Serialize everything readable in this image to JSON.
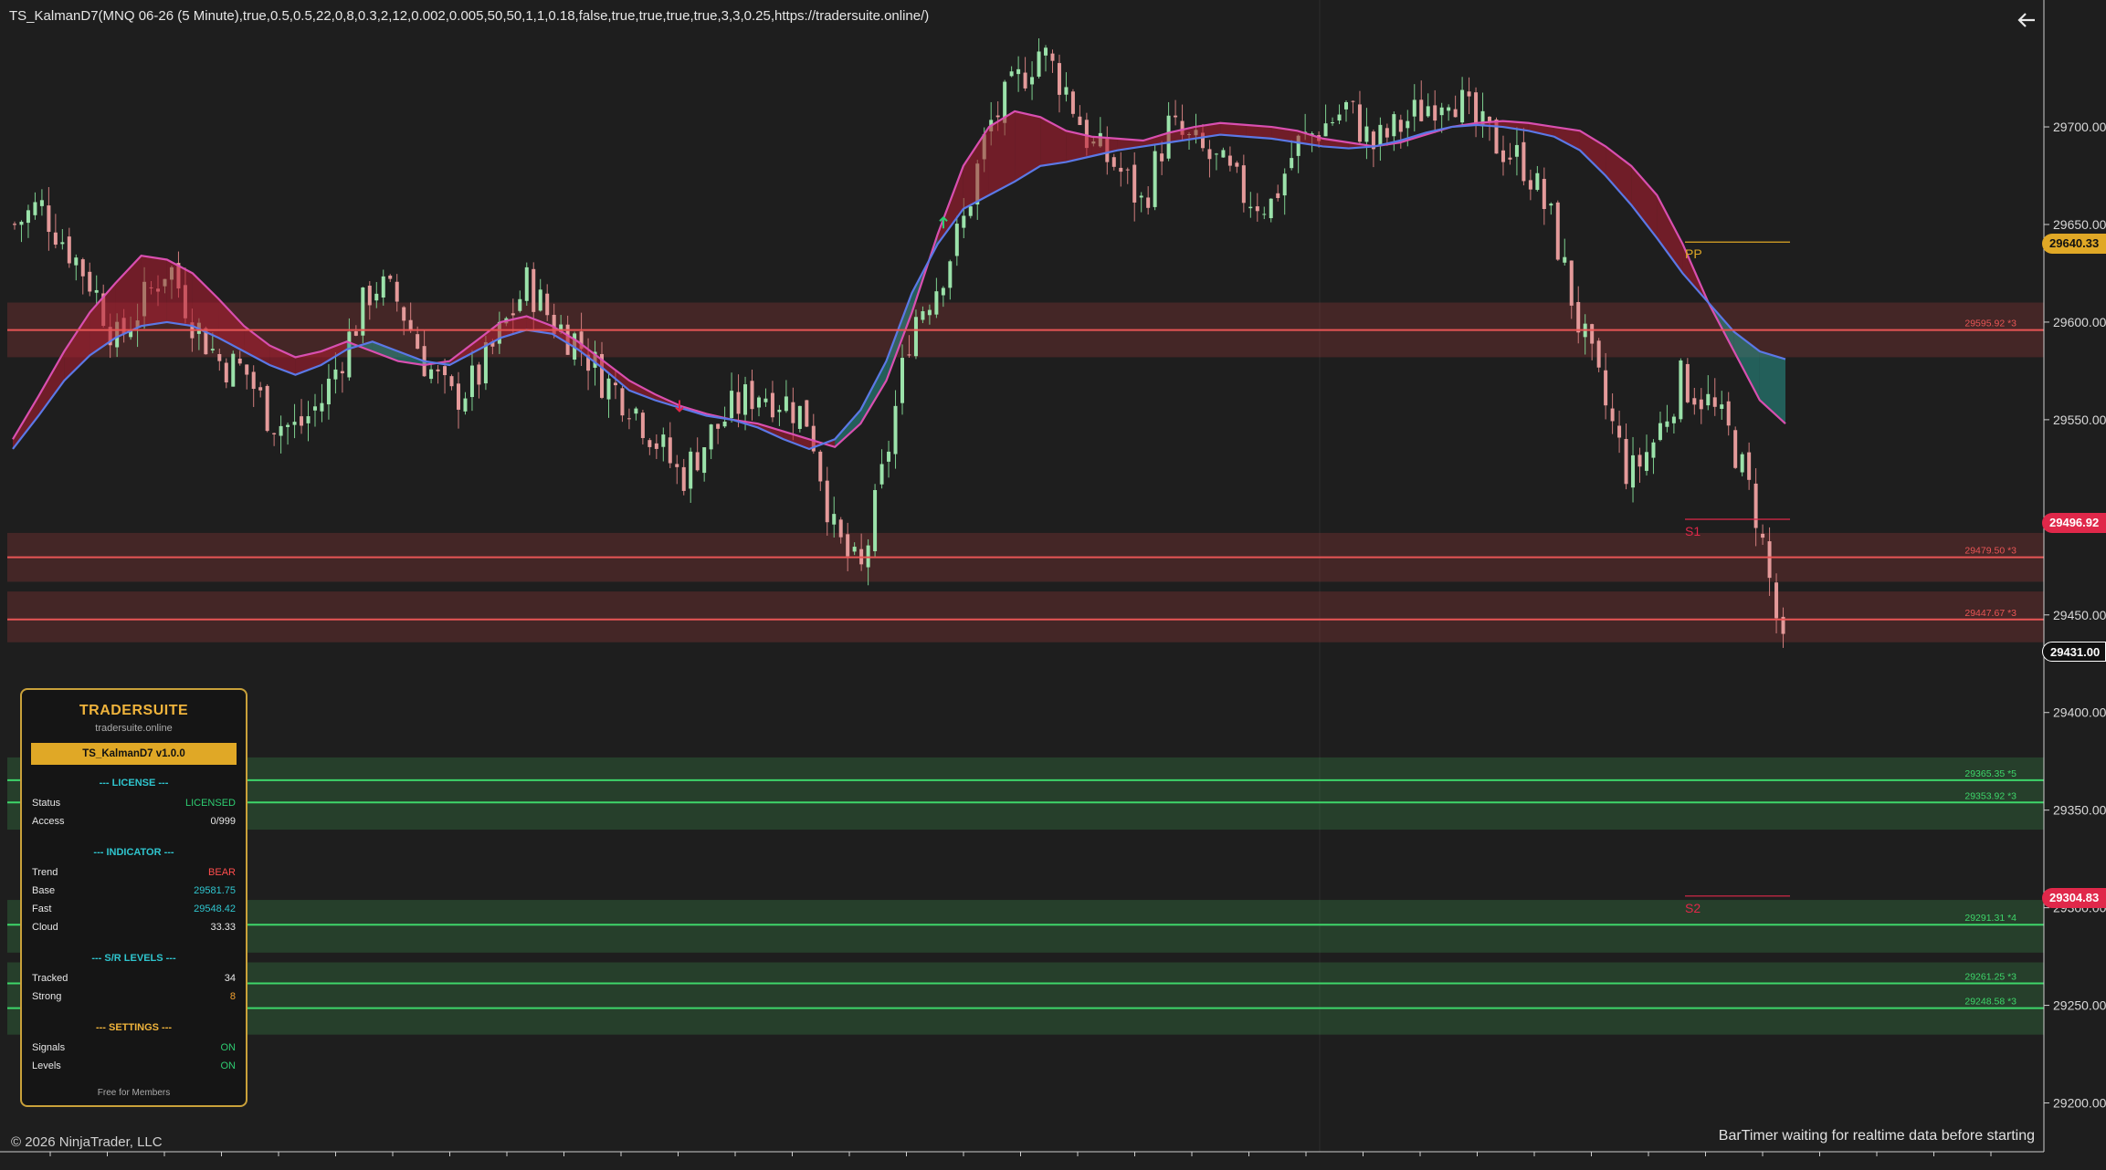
{
  "header": {
    "indicator_title": "TS_KalmanD7(MNQ 06-26 (5 Minute),true,0.5,0.5,22,0,8,0.3,2,12,0.002,0.005,50,50,1,1,0.18,false,true,true,true,true,3,3,0.25,https://tradersuite.online/)"
  },
  "footer": {
    "copyright": "© 2026 NinjaTrader, LLC",
    "bartimer": "BarTimer waiting for realtime data before starting"
  },
  "price_tags": [
    {
      "text": "29640.33",
      "price": 29640.33,
      "bg": "#e0a826",
      "fg": "#111111"
    },
    {
      "text": "29496.92",
      "price": 29496.92,
      "bg": "#e0284a",
      "fg": "#ffffff"
    },
    {
      "text": "29431.00",
      "price": 29431.0,
      "bg": "#111111",
      "fg": "#ffffff",
      "border": "#ffffff"
    },
    {
      "text": "29304.83",
      "price": 29304.83,
      "bg": "#e0284a",
      "fg": "#ffffff"
    }
  ],
  "panel": {
    "title": "TRADERSUITE",
    "subtitle": "tradersuite.online",
    "version": "TS_KalmanD7 v1.0.0",
    "license_header": "--- LICENSE ---",
    "status_label": "Status",
    "status_value": "LICENSED",
    "access_label": "Access",
    "access_value": "0/999",
    "indicator_header": "--- INDICATOR ---",
    "trend_label": "Trend",
    "trend_value": "BEAR",
    "base_label": "Base",
    "base_value": "29581.75",
    "fast_label": "Fast",
    "fast_value": "29548.42",
    "cloud_label": "Cloud",
    "cloud_value": "33.33",
    "sr_header": "--- S/R LEVELS ---",
    "tracked_label": "Tracked",
    "tracked_value": "34",
    "strong_label": "Strong",
    "strong_value": "8",
    "settings_header": "--- SETTINGS ---",
    "signals_label": "Signals",
    "signals_value": "ON",
    "levels_label": "Levels",
    "levels_value": "ON",
    "footer": "Free for Members",
    "colors": {
      "green": "#2ecc71",
      "red": "#ff4d4d",
      "cyan": "#2fc5ce",
      "orange": "#f0a030",
      "gold": "#e0a826"
    }
  },
  "chart_data": {
    "type": "candlestick",
    "instrument": "MNQ 06-26",
    "interval": "5 Minute",
    "ylim": [
      29175,
      29765
    ],
    "yticks": [
      {
        "value": 29200,
        "label": "29200.00"
      },
      {
        "value": 29250,
        "label": "29250.00"
      },
      {
        "value": 29300,
        "label": "29300.00"
      },
      {
        "value": 29350,
        "label": "29350.00"
      },
      {
        "value": 29400,
        "label": "29400.00"
      },
      {
        "value": 29450,
        "label": "29450.00"
      },
      {
        "value": 29500,
        "label": "29500.00"
      },
      {
        "value": 29550,
        "label": "29550.00"
      },
      {
        "value": 29600,
        "label": "29600.00"
      },
      {
        "value": 29650,
        "label": "29650.00"
      },
      {
        "value": 29700,
        "label": "29700.00"
      }
    ],
    "resistance_levels": [
      {
        "price": 29595.92,
        "label": "29595.92  *3",
        "zone": [
          29582,
          29610
        ]
      },
      {
        "price": 29479.5,
        "label": "29479.50  *3",
        "zone": [
          29467,
          29492
        ]
      },
      {
        "price": 29447.67,
        "label": "29447.67  *3",
        "zone": [
          29436,
          29462
        ]
      }
    ],
    "support_levels": [
      {
        "price": 29365.35,
        "label": "29365.35  *5",
        "zone": [
          29340,
          29377
        ]
      },
      {
        "price": 29353.92,
        "label": "29353.92  *3",
        "zone": [
          29340,
          29377
        ]
      },
      {
        "price": 29291.31,
        "label": "29291.31  *4",
        "zone": [
          29277,
          29304
        ]
      },
      {
        "price": 29261.25,
        "label": "29261.25  *3",
        "zone": [
          29235,
          29272
        ]
      },
      {
        "price": 29248.58,
        "label": "29248.58  *3",
        "zone": [
          29235,
          29272
        ]
      }
    ],
    "pivots": [
      {
        "name": "PP",
        "price": 29641,
        "color": "#e0a826"
      },
      {
        "name": "S1",
        "price": 29499,
        "color": "#e0284a"
      },
      {
        "name": "S2",
        "price": 29306,
        "color": "#e0284a"
      }
    ],
    "base_line": [
      29540,
      29562,
      29585,
      29605,
      29620,
      29634,
      29632,
      29625,
      29612,
      29598,
      29588,
      29582,
      29585,
      29590,
      29585,
      29580,
      29578,
      29580,
      29590,
      29600,
      29603,
      29598,
      29590,
      29580,
      29570,
      29563,
      29557,
      29553,
      29550,
      29548,
      29544,
      29540,
      29536,
      29548,
      29570,
      29605,
      29645,
      29680,
      29700,
      29708,
      29705,
      29698,
      29695,
      29694,
      29693,
      29697,
      29700,
      29702,
      29701,
      29700,
      29698,
      29694,
      29692,
      29690,
      29692,
      29696,
      29700,
      29702,
      29703,
      29702,
      29700,
      29698,
      29690,
      29680,
      29665,
      29640,
      29610,
      29585,
      29560,
      29548
    ],
    "fast_line": [
      29535,
      29552,
      29570,
      29583,
      29592,
      29598,
      29600,
      29598,
      29592,
      29585,
      29578,
      29573,
      29578,
      29586,
      29590,
      29585,
      29580,
      29578,
      29585,
      29592,
      29596,
      29594,
      29586,
      29576,
      29565,
      29560,
      29556,
      29552,
      29550,
      29546,
      29540,
      29535,
      29540,
      29555,
      29580,
      29615,
      29640,
      29658,
      29665,
      29672,
      29680,
      29682,
      29685,
      29688,
      29690,
      29692,
      29694,
      29696,
      29695,
      29694,
      29692,
      29690,
      29689,
      29690,
      29693,
      29697,
      29700,
      29701,
      29700,
      29698,
      29695,
      29688,
      29675,
      29660,
      29643,
      29625,
      29610,
      29595,
      29585,
      29581
    ],
    "close": [
      29650,
      29660,
      29640,
      29620,
      29590,
      29610,
      29630,
      29600,
      29580,
      29575,
      29550,
      29545,
      29560,
      29590,
      29620,
      29610,
      29580,
      29560,
      29570,
      29595,
      29620,
      29600,
      29590,
      29570,
      29560,
      29540,
      29520,
      29540,
      29555,
      29565,
      29560,
      29550,
      29490,
      29470,
      29530,
      29600,
      29620,
      29650,
      29700,
      29720,
      29740,
      29720,
      29690,
      29680,
      29660,
      29700,
      29690,
      29680,
      29665,
      29660,
      29690,
      29700,
      29710,
      29690,
      29700,
      29710,
      29720,
      29700,
      29690,
      29680,
      29650,
      29600,
      29560,
      29520,
      29540,
      29570,
      29560,
      29540,
      29500,
      29430
    ]
  },
  "signals": [
    {
      "type": "sell",
      "color": "#e0284a"
    },
    {
      "type": "buy",
      "color": "#2ecc71"
    }
  ]
}
